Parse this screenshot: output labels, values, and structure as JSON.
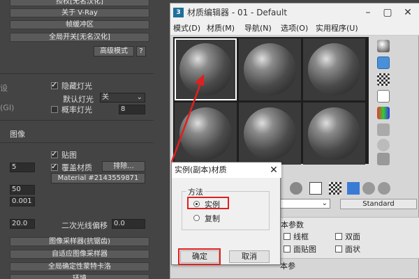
{
  "left_panel": {
    "rollouts": [
      "授权[无名汉化]",
      "关于 V-Ray",
      "帧缓冲区",
      "全局开关[无名汉化]",
      "图像采样器(抗锯齿)",
      "自适应图像采样器",
      "全局确定性蒙特卡洛",
      "环境"
    ],
    "advanced_mode_label": "高级模式",
    "help_label": "?",
    "hide_lights_label": "隐藏灯光",
    "default_lights_label": "默认灯光",
    "default_lights_value": "关",
    "probabilistic_lights_label": "概率灯光",
    "probabilistic_lights_value": "8",
    "map_label": "贴图",
    "override_material_label": "覆盖材质",
    "exclude_label": "排除...",
    "material_name": "Material #2143559871",
    "secondary_ray_bias_label": "二次光线偏移",
    "secondary_ray_bias_value": "0.0",
    "left_value_1": "50",
    "left_value_2": "0.001",
    "left_value_3": "20.0",
    "left_value_4": "5",
    "gi_fragment": "(GI)",
    "image_fragment": "图像",
    "settings_fragment": "设"
  },
  "material_editor": {
    "title": "材质编辑器 - 01 - Default",
    "logo": "3",
    "menu": [
      "模式(D)",
      "材质(M)",
      "导航(N)",
      "选项(O)",
      "实用程序(U)"
    ],
    "standard_label": "Standard",
    "params": {
      "rollout_label": "本参数",
      "wire": "线框",
      "two_sided": "双面",
      "face_map": "面贴图",
      "faceted": "面状",
      "lower_label": "本参"
    }
  },
  "dialog": {
    "title": "实例(副本)材质",
    "close": "✕",
    "group_label": "方法",
    "option_instance": "实例",
    "option_copy": "复制",
    "ok_label": "确定",
    "cancel_label": "取消"
  },
  "colors": {
    "highlight": "#e02020",
    "panel_bg": "#444444",
    "window_bg": "#d6d6d6"
  }
}
